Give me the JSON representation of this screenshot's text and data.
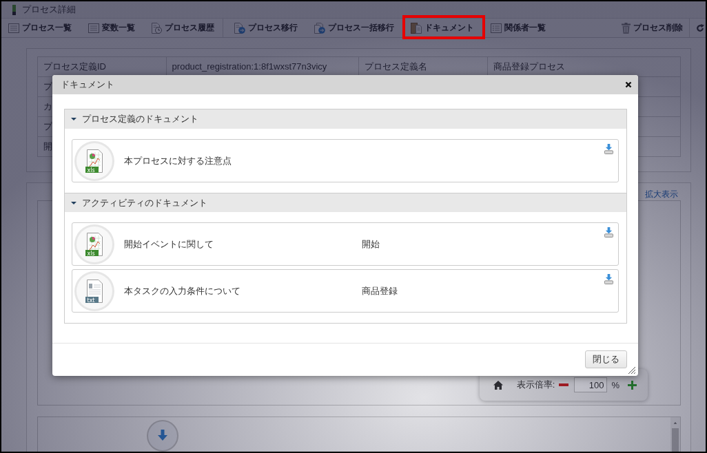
{
  "window": {
    "title": "プロセス詳細"
  },
  "toolbar": {
    "left": [
      [
        {
          "kind": "list",
          "label": "プロセス一覧",
          "highlighted": false
        },
        {
          "kind": "list",
          "label": "変数一覧",
          "highlighted": false
        },
        {
          "kind": "history",
          "label": "プロセス履歴",
          "highlighted": false
        }
      ],
      [
        {
          "kind": "move",
          "label": "プロセス移行",
          "highlighted": false
        },
        {
          "kind": "bulkmove",
          "label": "プロセス一括移行",
          "highlighted": false
        },
        {
          "kind": "document",
          "label": "ドキュメント",
          "highlighted": true
        },
        {
          "kind": "people",
          "label": "関係者一覧",
          "highlighted": false
        }
      ]
    ],
    "right": [
      [
        {
          "kind": "delete",
          "label": "プロセス削除",
          "highlighted": false
        }
      ],
      [
        {
          "kind": "refresh",
          "highlighted": false
        }
      ]
    ]
  },
  "details": {
    "rows": [
      {
        "cells": [
          "プロセス定義ID",
          "product_registration:1:8f1wxst77n3vicy",
          "プロセス定義名",
          "商品登録プロセス"
        ]
      },
      {
        "cells": [
          "プ"
        ]
      },
      {
        "cells": [
          "カ"
        ]
      },
      {
        "cells": [
          "プ"
        ]
      },
      {
        "cells": [
          "開"
        ]
      }
    ]
  },
  "diagram": {
    "link": "拡大表示",
    "zoom": {
      "label": "表示倍率:",
      "value": "100",
      "unit": "%"
    }
  },
  "dialog": {
    "title": "ドキュメント",
    "sections": [
      {
        "title": "プロセス定義のドキュメント",
        "expanded": true,
        "documents": [
          {
            "kind": "spreadsheet",
            "badge": "xls",
            "name": "本プロセスに対する注意点"
          }
        ]
      },
      {
        "title": "アクティビティのドキュメント",
        "expanded": true,
        "documents": [
          {
            "kind": "spreadsheet",
            "badge": "xls",
            "name": "開始イベントに関して",
            "activity": "開始"
          },
          {
            "kind": "text",
            "badge": "txt",
            "name": "本タスクの入力条件について",
            "activity": "商品登録"
          }
        ]
      }
    ],
    "button": "閉じる"
  }
}
